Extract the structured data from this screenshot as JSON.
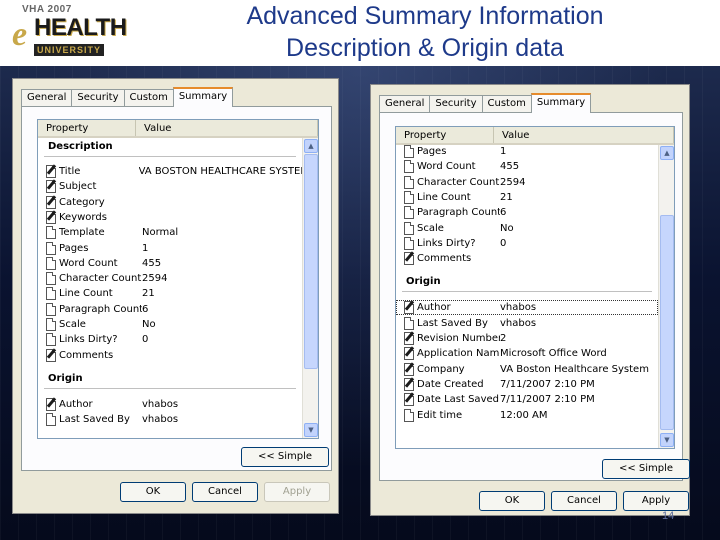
{
  "slide": {
    "title_line1": "Advanced Summary Information",
    "title_line2": "Description & Origin data",
    "slide_number": "14",
    "logo": {
      "top": "VHA 2007",
      "e": "e",
      "main": "HEALTH",
      "bottom": "UNIVERSITY"
    }
  },
  "dialog1": {
    "tabs": [
      "General",
      "Security",
      "Custom",
      "Summary"
    ],
    "active_tab": "Summary",
    "columns": [
      "Property",
      "Value"
    ],
    "group_description": "Description",
    "description_rows": [
      {
        "icon": "edit-page-icon",
        "name": "Title",
        "value": "VA BOSTON HEALTHCARE SYSTEM"
      },
      {
        "icon": "edit-page-icon",
        "name": "Subject",
        "value": ""
      },
      {
        "icon": "edit-page-icon",
        "name": "Category",
        "value": ""
      },
      {
        "icon": "edit-page-icon",
        "name": "Keywords",
        "value": ""
      },
      {
        "icon": "page-icon",
        "name": "Template",
        "value": "Normal"
      },
      {
        "icon": "page-icon",
        "name": "Pages",
        "value": "1"
      },
      {
        "icon": "page-icon",
        "name": "Word Count",
        "value": "455"
      },
      {
        "icon": "page-icon",
        "name": "Character Count",
        "value": "2594"
      },
      {
        "icon": "page-icon",
        "name": "Line Count",
        "value": "21"
      },
      {
        "icon": "page-icon",
        "name": "Paragraph Count",
        "value": "6"
      },
      {
        "icon": "page-icon",
        "name": "Scale",
        "value": "No"
      },
      {
        "icon": "page-icon",
        "name": "Links Dirty?",
        "value": "0"
      },
      {
        "icon": "edit-page-icon",
        "name": "Comments",
        "value": ""
      }
    ],
    "group_origin": "Origin",
    "origin_rows": [
      {
        "icon": "edit-page-icon",
        "name": "Author",
        "value": "vhabos"
      },
      {
        "icon": "page-icon",
        "name": "Last Saved By",
        "value": "vhabos"
      }
    ],
    "simple_button": "<< Simple",
    "ok": "OK",
    "cancel": "Cancel",
    "apply": "Apply"
  },
  "dialog2": {
    "tabs": [
      "General",
      "Security",
      "Custom",
      "Summary"
    ],
    "active_tab": "Summary",
    "columns": [
      "Property",
      "Value"
    ],
    "top_rows": [
      {
        "icon": "page-icon",
        "name": "Pages",
        "value": "1"
      },
      {
        "icon": "page-icon",
        "name": "Word Count",
        "value": "455"
      },
      {
        "icon": "page-icon",
        "name": "Character Count",
        "value": "2594"
      },
      {
        "icon": "page-icon",
        "name": "Line Count",
        "value": "21"
      },
      {
        "icon": "page-icon",
        "name": "Paragraph Count",
        "value": "6"
      },
      {
        "icon": "page-icon",
        "name": "Scale",
        "value": "No"
      },
      {
        "icon": "page-icon",
        "name": "Links Dirty?",
        "value": "0"
      },
      {
        "icon": "edit-page-icon",
        "name": "Comments",
        "value": ""
      }
    ],
    "group_origin": "Origin",
    "origin_rows": [
      {
        "icon": "edit-page-icon",
        "name": "Author",
        "value": "vhabos",
        "selected": true
      },
      {
        "icon": "page-icon",
        "name": "Last Saved By",
        "value": "vhabos"
      },
      {
        "icon": "edit-page-icon",
        "name": "Revision Number",
        "value": "2"
      },
      {
        "icon": "edit-page-icon",
        "name": "Application Name",
        "value": "Microsoft Office Word"
      },
      {
        "icon": "edit-page-icon",
        "name": "Company",
        "value": "VA Boston Healthcare System"
      },
      {
        "icon": "edit-page-icon",
        "name": "Date Created",
        "value": "7/11/2007 2:10 PM"
      },
      {
        "icon": "edit-page-icon",
        "name": "Date Last Saved",
        "value": "7/11/2007 2:10 PM"
      },
      {
        "icon": "page-icon",
        "name": "Edit time",
        "value": "12:00 AM"
      }
    ],
    "simple_button": "<< Simple",
    "ok": "OK",
    "cancel": "Cancel",
    "apply": "Apply"
  }
}
